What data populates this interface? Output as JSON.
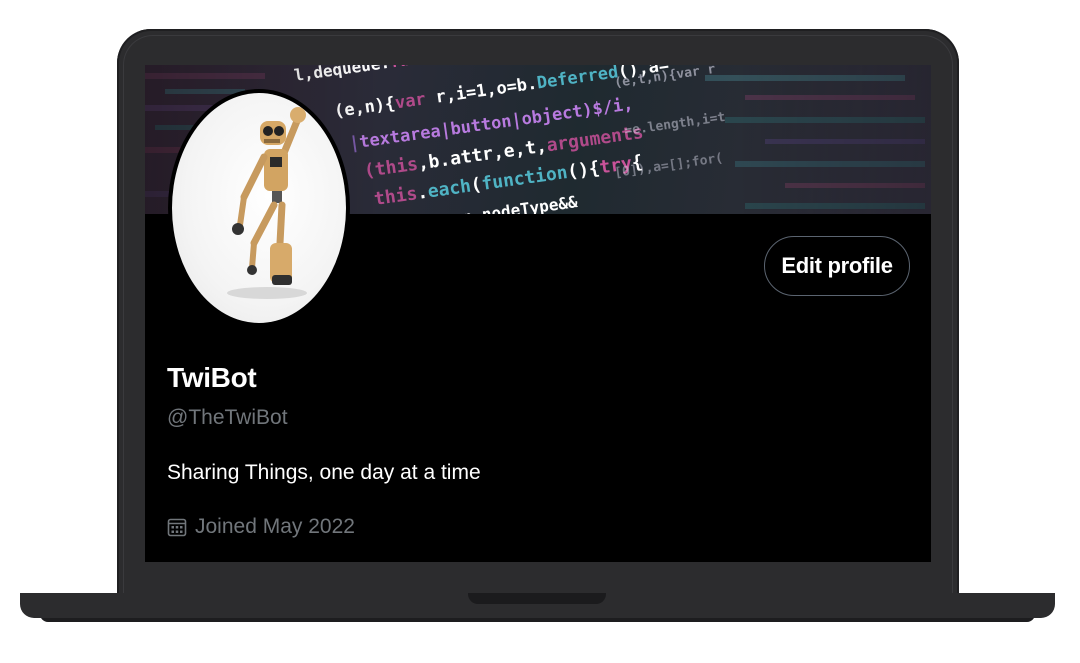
{
  "profile": {
    "display_name": "TwiBot",
    "handle": "@TheTwiBot",
    "bio": "Sharing Things, one day at a time",
    "joined": "Joined May 2022"
  },
  "actions": {
    "edit_profile_label": "Edit profile"
  },
  "banner": {
    "code_lines": [
      "l,dequeue:function(e){retur",
      "(e,n){var r,i=1,o=b.Deferred(),a=",
      "|textarea|button|object)$/i,",
      "(this,b.attr,e,t,arguments",
      "this.each(function(){try{",
      ".n.nodeType&&"
    ]
  },
  "icons": {
    "joined": "calendar-icon",
    "avatar": "robot-avatar"
  },
  "colors": {
    "background": "#000000",
    "text_primary": "#ffffff",
    "text_secondary": "#71767b",
    "button_border": "#5b6470",
    "laptop_frame": "#2c2c2e"
  }
}
